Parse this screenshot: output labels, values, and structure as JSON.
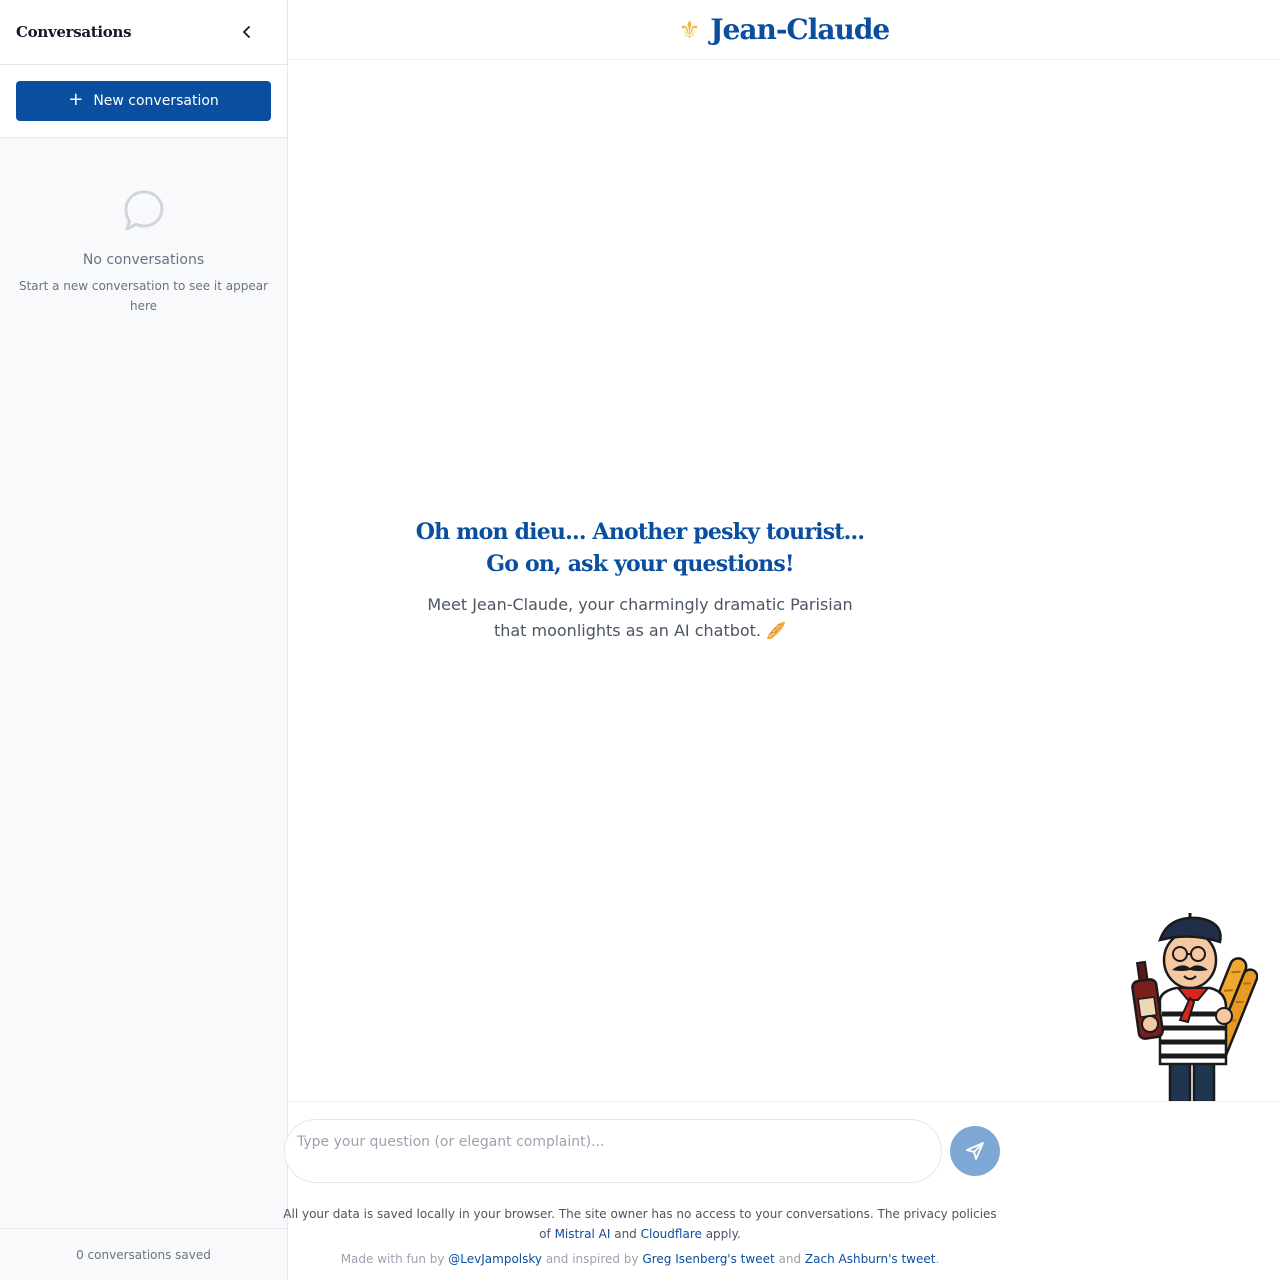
{
  "sidebar": {
    "title": "Conversations",
    "new_conversation_label": "New conversation",
    "empty_title": "No conversations",
    "empty_subtitle": "Start a new conversation to see it appear here",
    "footer": "0 conversations saved"
  },
  "header": {
    "brand_icon": "⚜",
    "brand_name": "Jean-Claude"
  },
  "welcome": {
    "title_line1": "Oh mon dieu... Another pesky tourist...",
    "title_line2": "Go on, ask your questions!",
    "subtitle_line1": "Meet Jean-Claude, your charmingly dramatic Parisian",
    "subtitle_line2": "that moonlights as an AI chatbot.",
    "subtitle_emoji": "🥖"
  },
  "composer": {
    "placeholder": "Type your question (or elegant complaint)..."
  },
  "privacy": {
    "text1": "All your data is saved locally in your browser. The site owner has no access to your conversations. The privacy policies of",
    "link1": "Mistral AI",
    "and": "and",
    "link2": "Cloudflare",
    "text2": "apply."
  },
  "credits": {
    "prefix": "Made with fun by",
    "author": "@LevJampolsky",
    "inspired": "and inspired by",
    "tweet1": "Greg Isenberg's tweet",
    "and": "and",
    "tweet2": "Zach Ashburn's tweet",
    "suffix": "."
  },
  "colors": {
    "brand_blue": "#0a4ea0",
    "accent_gold": "#f3b539",
    "send_button": "#7da8d6"
  },
  "icons": {
    "collapse": "chevron-left-icon",
    "new": "plus-icon",
    "empty": "chat-bubble-icon",
    "send": "send-icon"
  }
}
